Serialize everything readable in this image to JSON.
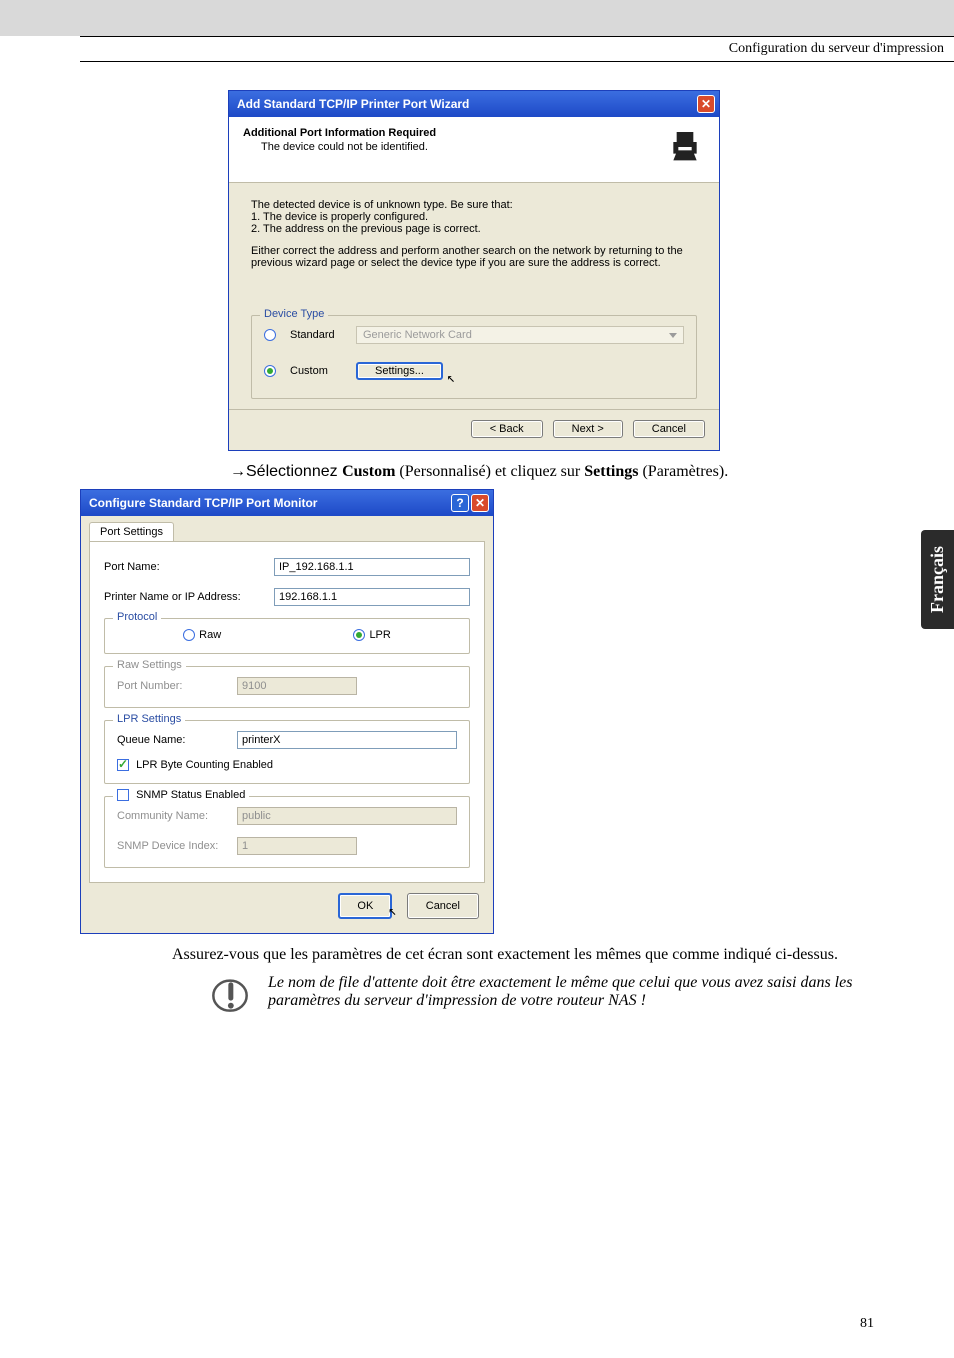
{
  "header": {
    "title": "Configuration du serveur d'impression"
  },
  "dlg1": {
    "title": "Add Standard TCP/IP Printer Port Wizard",
    "heading": "Additional Port Information Required",
    "subheading": "The device could not be identified.",
    "body_intro": "The detected device is of unknown type.  Be sure that:",
    "body_bullets": [
      "1. The device is properly configured.",
      "2.  The address on the previous page is correct."
    ],
    "body_tail": "Either correct the address and perform another search on the network by returning to the previous wizard page or select the device type if you are sure the address is correct.",
    "devicetype_legend": "Device Type",
    "standard_label": "Standard",
    "standard_value": "Generic Network Card",
    "custom_label": "Custom",
    "settings_button": "Settings...",
    "back": "< Back",
    "next": "Next >",
    "cancel": "Cancel"
  },
  "instruction1": {
    "prefix": "→Sélectionnez ",
    "b1": "Custom",
    "mid": " (Personnalisé) et cliquez sur ",
    "b2": "Settings",
    "suffix": " (Paramètres)."
  },
  "dlg2": {
    "title": "Configure Standard TCP/IP Port Monitor",
    "tab": "Port Settings",
    "portname_label": "Port Name:",
    "portname_value": "IP_192.168.1.1",
    "printerip_label": "Printer Name or IP Address:",
    "printerip_value": "192.168.1.1",
    "protocol_legend": "Protocol",
    "raw_label": "Raw",
    "lpr_label": "LPR",
    "raw_legend": "Raw Settings",
    "raw_portnum_label": "Port Number:",
    "raw_portnum_value": "9100",
    "lpr_legend": "LPR Settings",
    "queue_label": "Queue Name:",
    "queue_value": "printerX",
    "lpr_bytecount": "LPR Byte Counting Enabled",
    "snmp_legend": "SNMP Status Enabled",
    "community_label": "Community Name:",
    "community_value": "public",
    "snmpidx_label": "SNMP Device Index:",
    "snmpidx_value": "1",
    "ok": "OK",
    "cancel": "Cancel"
  },
  "para2": "Assurez-vous que les paramètres de cet écran sont exactement les mêmes que comme indiqué ci-dessus.",
  "note": "Le nom de file d'attente doit être exactement le même que celui que vous avez saisi dans les paramètres du serveur d'impression de votre routeur NAS !",
  "sidetab": "Français",
  "pagenum": "81"
}
